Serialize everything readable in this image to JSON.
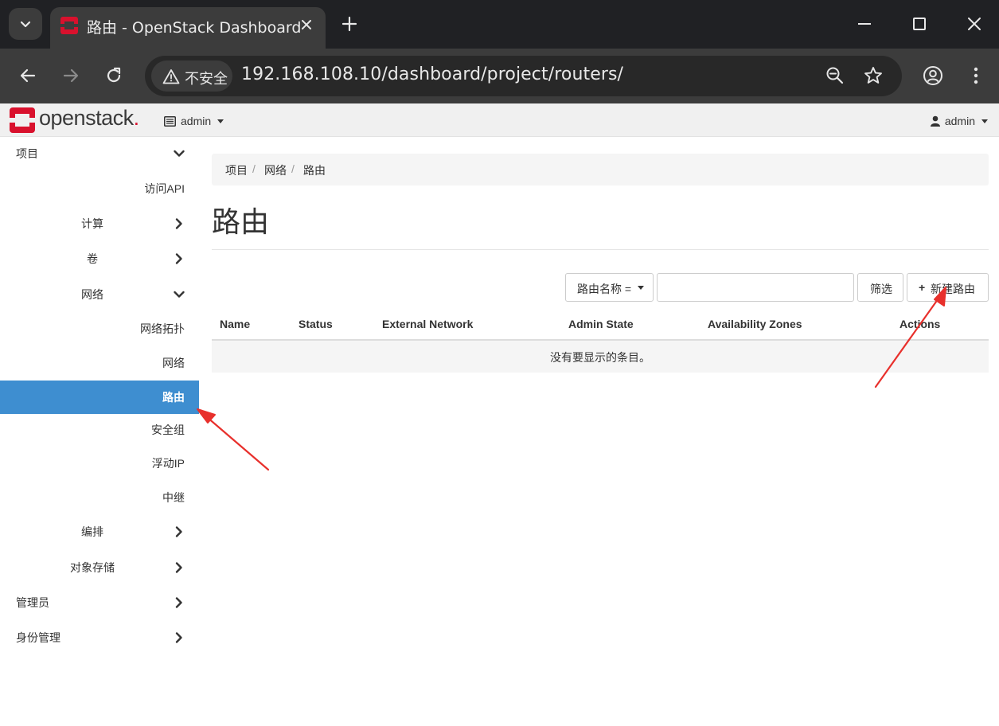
{
  "browser": {
    "tab_title": "路由 - OpenStack Dashboard",
    "security_label": "不安全",
    "url": "192.168.108.10/dashboard/project/routers/",
    "icons": [
      "tab-search-icon",
      "close-icon",
      "plus-icon",
      "back-icon",
      "forward-icon",
      "reload-icon",
      "warning-icon",
      "zoom-icon",
      "star-icon",
      "profile-icon",
      "more-icon"
    ]
  },
  "header": {
    "brand": "openstack",
    "brand_suffix": ".",
    "project": "admin",
    "user": "admin"
  },
  "sidebar": {
    "items": [
      {
        "label": "项目",
        "chevron": "down"
      },
      {
        "label": "访问API"
      },
      {
        "label": "计算",
        "chevron": "right"
      },
      {
        "label": "卷",
        "chevron": "right"
      },
      {
        "label": "网络",
        "chevron": "down"
      },
      {
        "label": "网络拓扑"
      },
      {
        "label": "网络"
      },
      {
        "label": "路由",
        "active": true
      },
      {
        "label": "安全组"
      },
      {
        "label": "浮动IP"
      },
      {
        "label": "中继"
      },
      {
        "label": "编排",
        "chevron": "right"
      },
      {
        "label": "对象存储",
        "chevron": "right"
      },
      {
        "label": "管理员",
        "chevron": "right"
      },
      {
        "label": "身份管理",
        "chevron": "right"
      }
    ]
  },
  "main": {
    "breadcrumb": [
      "项目",
      "网络",
      "路由"
    ],
    "title": "路由",
    "filter": {
      "field_label": "路由名称 =",
      "value": "",
      "button_label": "筛选"
    },
    "create_button_label": "新建路由",
    "table": {
      "columns": [
        "Name",
        "Status",
        "External Network",
        "Admin State",
        "Availability Zones",
        "Actions"
      ],
      "empty_message": "没有要显示的条目。"
    }
  },
  "colors": {
    "brand_red": "#d9112d",
    "sidebar_active": "#3e8ed0",
    "annotation_arrow": "#e8302c"
  }
}
